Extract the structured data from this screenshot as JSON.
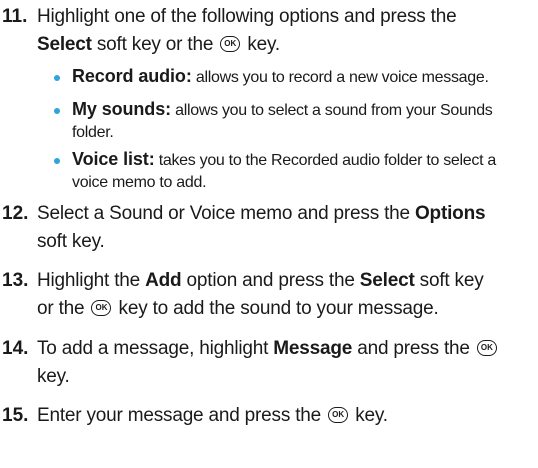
{
  "ok_key_label": "OK",
  "steps": [
    {
      "number": "11.",
      "line1": "Highlight one of the following options and press the",
      "line2_bold": "Select",
      "line2_rest_a": " soft key or the ",
      "line2_rest_b": " key.",
      "options": [
        {
          "title": "Record audio:",
          "text": " allows you to record a new voice message."
        },
        {
          "title": "My sounds:",
          "text": " allows you to select a sound from your Sounds",
          "continuation": "folder."
        },
        {
          "title": "Voice list:",
          "text": " takes you to the Recorded audio folder to select a",
          "continuation": "voice memo to add."
        }
      ]
    },
    {
      "number": "12.",
      "line1_a": "Select a Sound or Voice memo and press the ",
      "line1_bold": "Options",
      "line2": "soft key."
    },
    {
      "number": "13.",
      "line1_a": " Highlight the ",
      "line1_bold1": "Add",
      "line1_b": " option and press the ",
      "line1_bold2": "Select",
      "line1_c": " soft key",
      "line2_a": "or the ",
      "line2_b": " key to add the sound to your message."
    },
    {
      "number": "14.",
      "line1_a": "To add a message, highlight ",
      "line1_bold": "Message",
      "line1_b": " and press the ",
      "line2": "key."
    },
    {
      "number": "15.",
      "line1_a": "Enter your message and press the ",
      "line1_b": " key."
    }
  ],
  "colors": {
    "bullet": "#2ea3dc",
    "text": "#1a1a1a"
  }
}
